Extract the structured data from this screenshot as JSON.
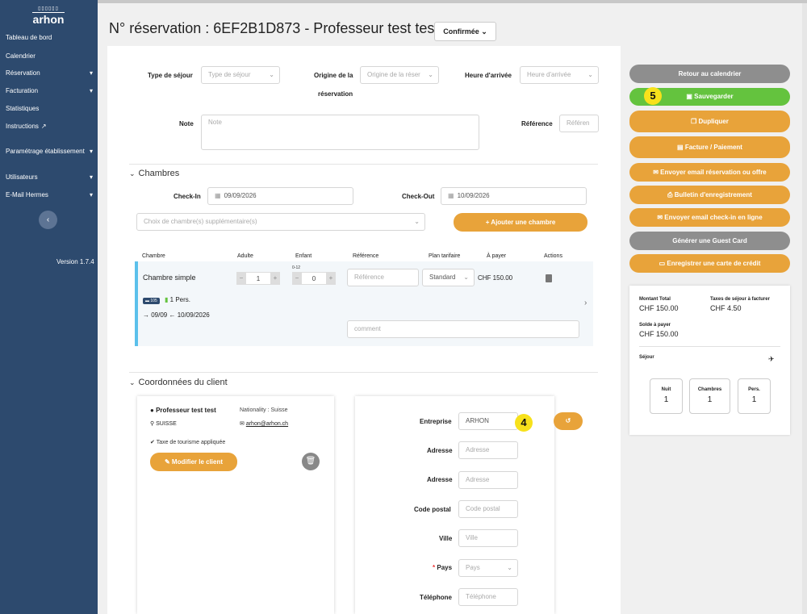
{
  "sidebar": {
    "logo_text": "arhon",
    "logo_mark": "▯▯▯▯▯▯",
    "items": [
      {
        "label": "Tableau de bord",
        "chevron": ""
      },
      {
        "label": "Calendrier",
        "chevron": ""
      },
      {
        "label": "Réservation",
        "chevron": "⌄"
      },
      {
        "label": "Facturation",
        "chevron": "⌄"
      },
      {
        "label": "Statistiques",
        "chevron": ""
      },
      {
        "label": "Instructions",
        "chevron": ""
      },
      {
        "label": "Paramétrage établissement",
        "chevron": "⌄"
      },
      {
        "label": "Utilisateurs",
        "chevron": "⌄"
      },
      {
        "label": "E-Mail Hermes",
        "chevron": "⌄"
      }
    ],
    "collapse_icon": "‹",
    "version": "Version 1.7.4"
  },
  "header": {
    "title": "N° réservation : 6EF2B1D873 - Professeur test test",
    "status": "Confirmée"
  },
  "form": {
    "type_sejour_label": "Type de séjour",
    "type_sejour_placeholder": "Type de séjour",
    "origine_label_1": "Origine de la",
    "origine_label_2": "réservation",
    "origine_placeholder": "Origine de la réser",
    "heure_label": "Heure d'arrivée",
    "heure_placeholder": "Heure d'arrivée",
    "note_label": "Note",
    "note_placeholder": "Note",
    "reference_label": "Référence",
    "reference_placeholder": "Référen"
  },
  "chambres": {
    "title": "Chambres",
    "checkin_label": "Check-In",
    "checkin_value": "09/09/2026",
    "checkout_label": "Check-Out",
    "checkout_value": "10/09/2026",
    "choice_placeholder": "Choix de chambre(s) supplémentaire(s)",
    "add_button": "+  Ajouter une chambre",
    "headers": [
      "Chambre",
      "Adulte",
      "Enfant",
      "Référence",
      "Plan tarifaire",
      "À payer",
      "Actions"
    ],
    "enfant_hint": "0-12",
    "row": {
      "name": "Chambre simple",
      "adults": "1",
      "children": "0",
      "reference_placeholder": "Référence",
      "plan": "Standard",
      "price": "CHF 150.00",
      "room_badge": "105",
      "persons": "1 Pers.",
      "dates": "09/09 ← 10/09/2026",
      "comment_placeholder": "comment"
    }
  },
  "client": {
    "title": "Coordonnées du client",
    "name": "Professeur  test test",
    "nationality": "Nationality : Suisse",
    "country": "SUISSE",
    "email": "arhon@arhon.ch",
    "tax_note": "Taxe de tourisme appliquée",
    "edit_button": "Modifier le client",
    "entreprise_label": "Entreprise",
    "entreprise_value": "ARHON",
    "adresse_label": "Adresse",
    "adresse_placeholder": "Adresse",
    "cp_label": "Code postal",
    "cp_placeholder": "Code postal",
    "ville_label": "Ville",
    "ville_placeholder": "Ville",
    "pays_label": "Pays",
    "pays_placeholder": "Pays",
    "tel_label": "Téléphone",
    "tel_placeholder": "Téléphone"
  },
  "actions": {
    "back": "Retour au calendrier",
    "save": "Sauvegarder",
    "duplicate": "Dupliquer",
    "invoice": "Facture / Paiement",
    "email_offer": "Envoyer email réservation ou offre",
    "bulletin": "Bulletin d'enregistrement",
    "email_checkin": "Envoyer email check-in en ligne",
    "guest_card": "Générer une Guest Card",
    "credit_card": "Enregistrer une carte de crédit"
  },
  "summary": {
    "total_label": "Montant Total",
    "total_value": "CHF 150.00",
    "tax_label": "Taxes de séjour à facturer",
    "tax_value": "CHF 4.50",
    "balance_label": "Solde à payer",
    "balance_value": "CHF 150.00",
    "stay_label": "Séjour",
    "nights_label": "Nuit",
    "nights_value": "1",
    "rooms_label": "Chambres",
    "rooms_value": "1",
    "persons_label": "Pers.",
    "persons_value": "1"
  },
  "badges": {
    "b4": "4",
    "b5": "5"
  },
  "colors": {
    "sidebar": "#2d4a6e",
    "orange": "#e8a33a",
    "green": "#64c33e",
    "grey": "#8e8e8e",
    "badge": "#f7e11b",
    "row_accent": "#5bc0eb"
  }
}
